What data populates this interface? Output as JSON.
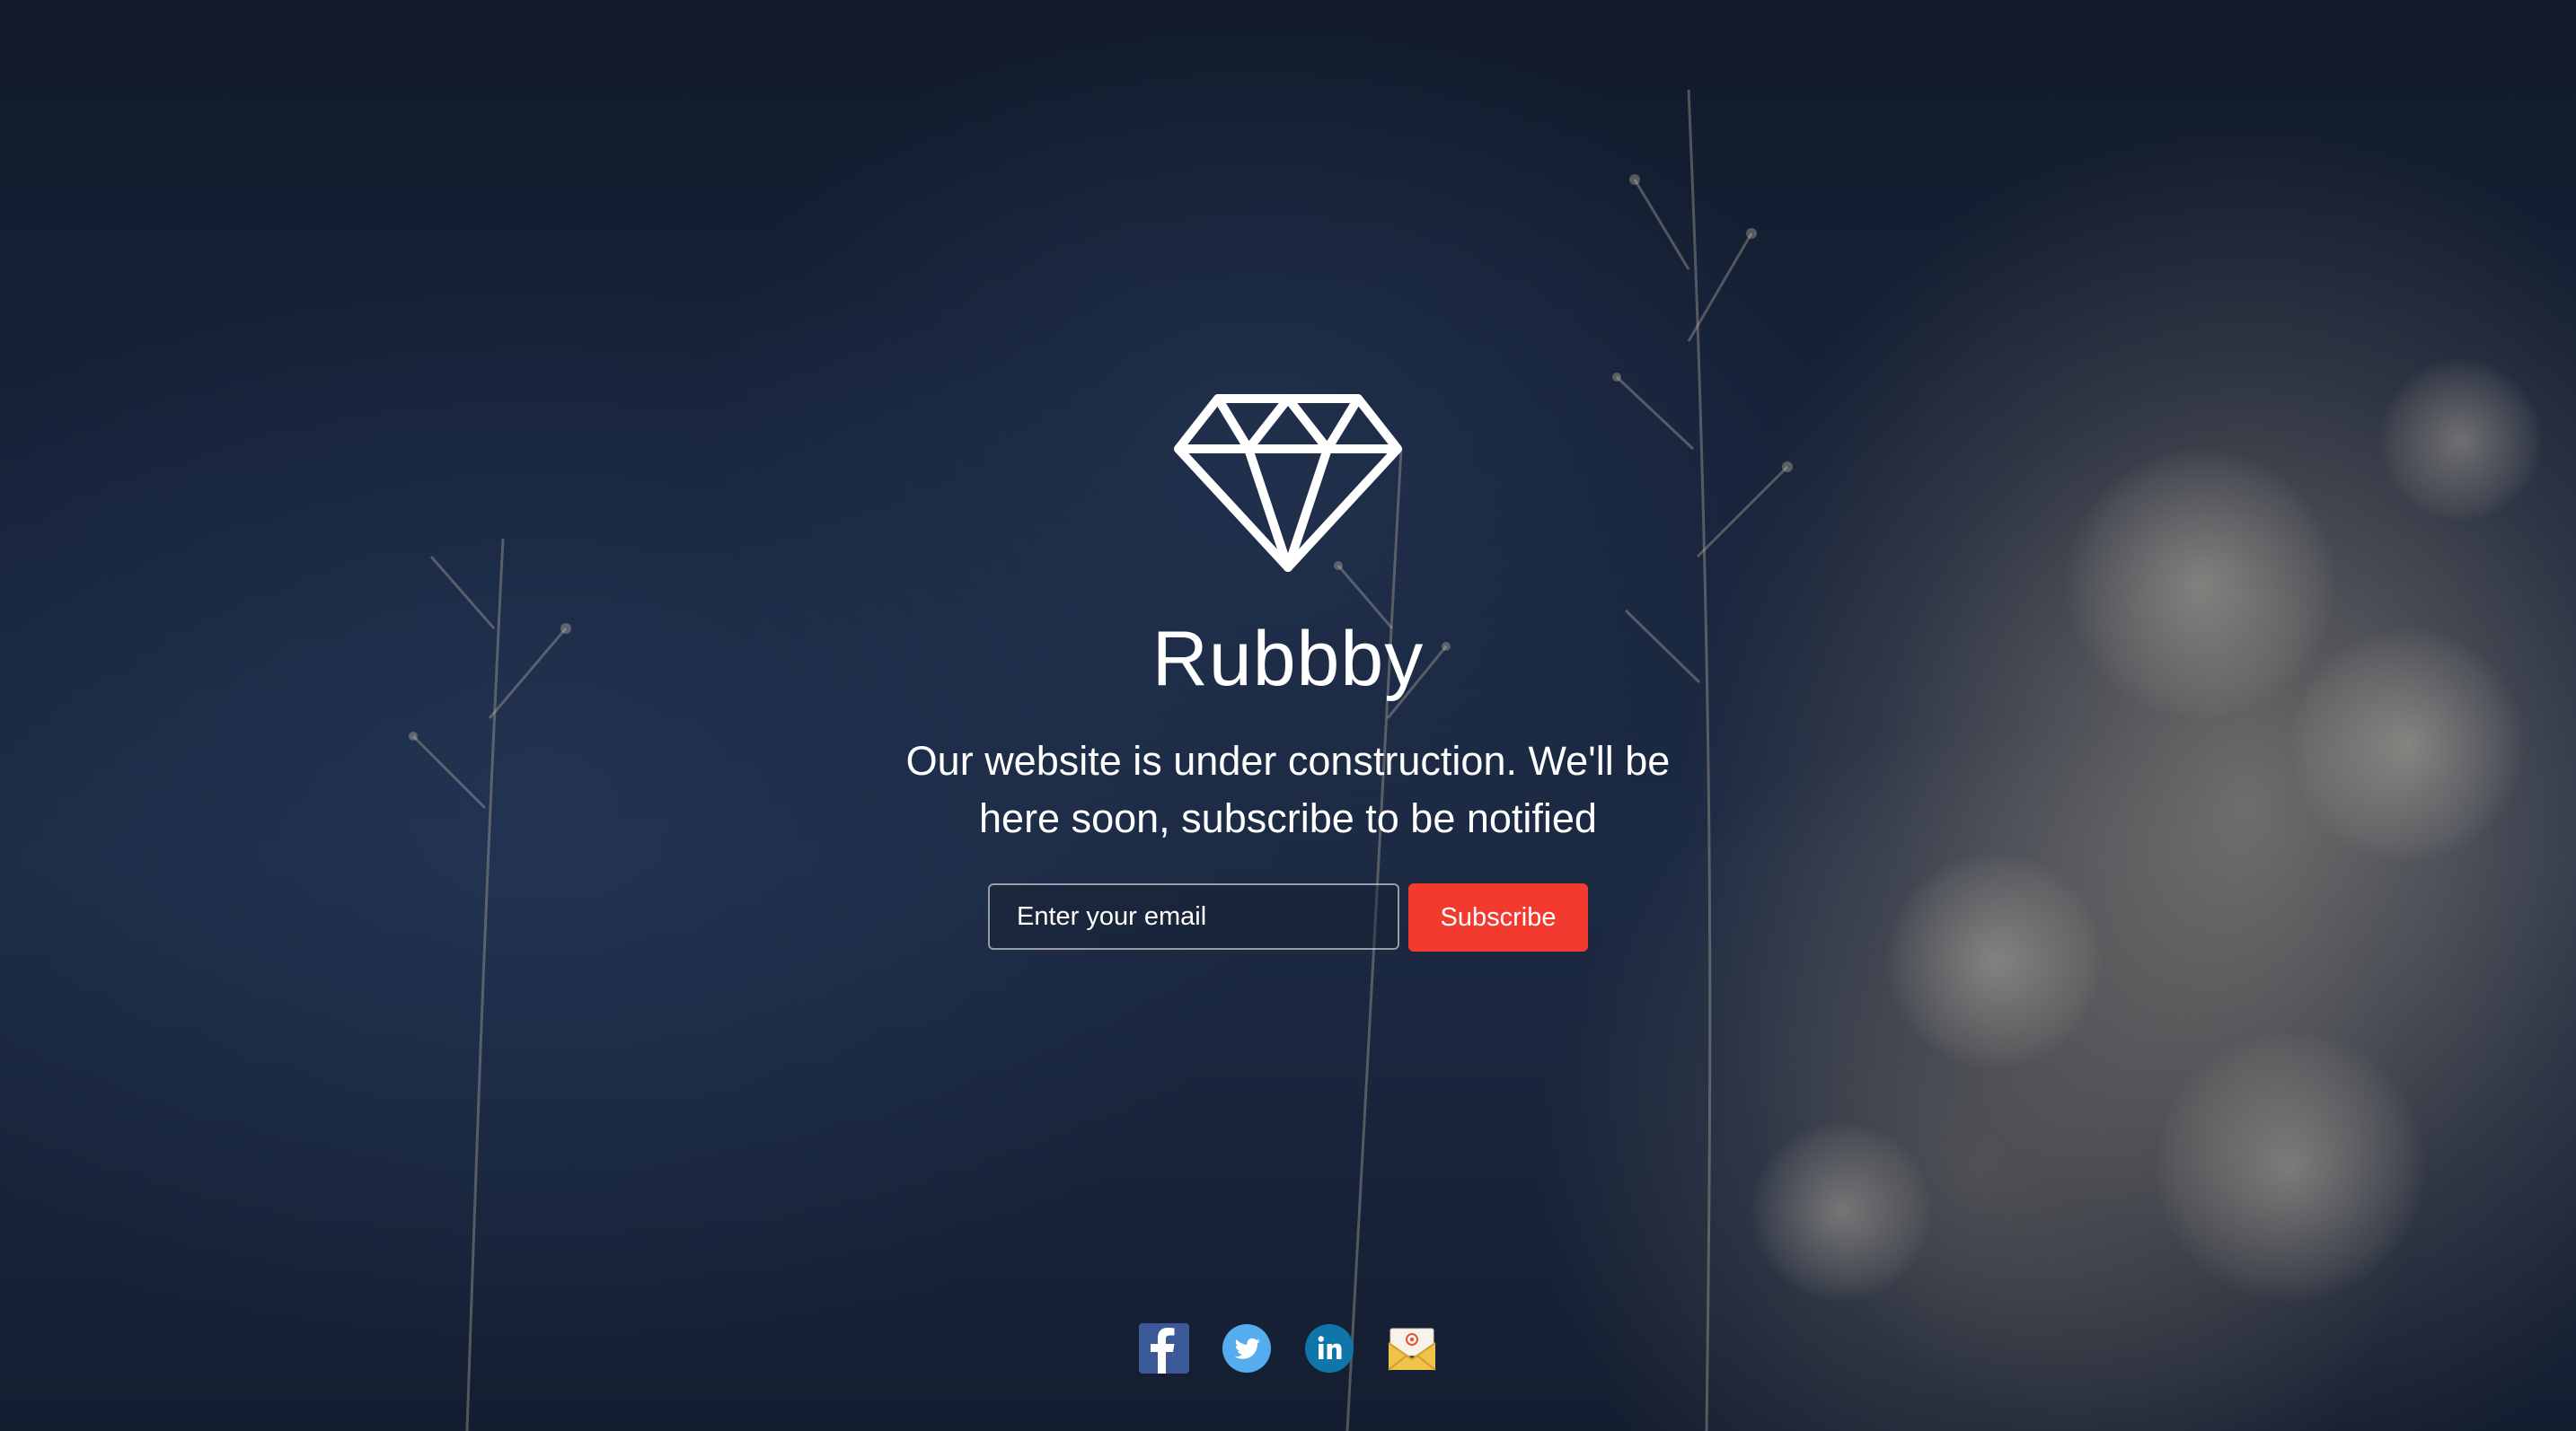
{
  "brand": {
    "name": "Rubbby",
    "logo_icon": "diamond-icon"
  },
  "hero": {
    "tagline_line1": "Our website is under construction. We'll be",
    "tagline_line2": "here soon, subscribe to be notified"
  },
  "subscribe_form": {
    "email_placeholder": "Enter your email",
    "email_value": "",
    "button_label": "Subscribe"
  },
  "social_links": [
    {
      "icon": "facebook-icon",
      "color": "#3b5998"
    },
    {
      "icon": "twitter-icon",
      "color": "#55acee"
    },
    {
      "icon": "linkedin-icon",
      "color": "#0e76a8"
    },
    {
      "icon": "email-icon",
      "color": "#f0c14b"
    }
  ],
  "colors": {
    "accent": "#f23a2f",
    "text": "#ffffff"
  }
}
